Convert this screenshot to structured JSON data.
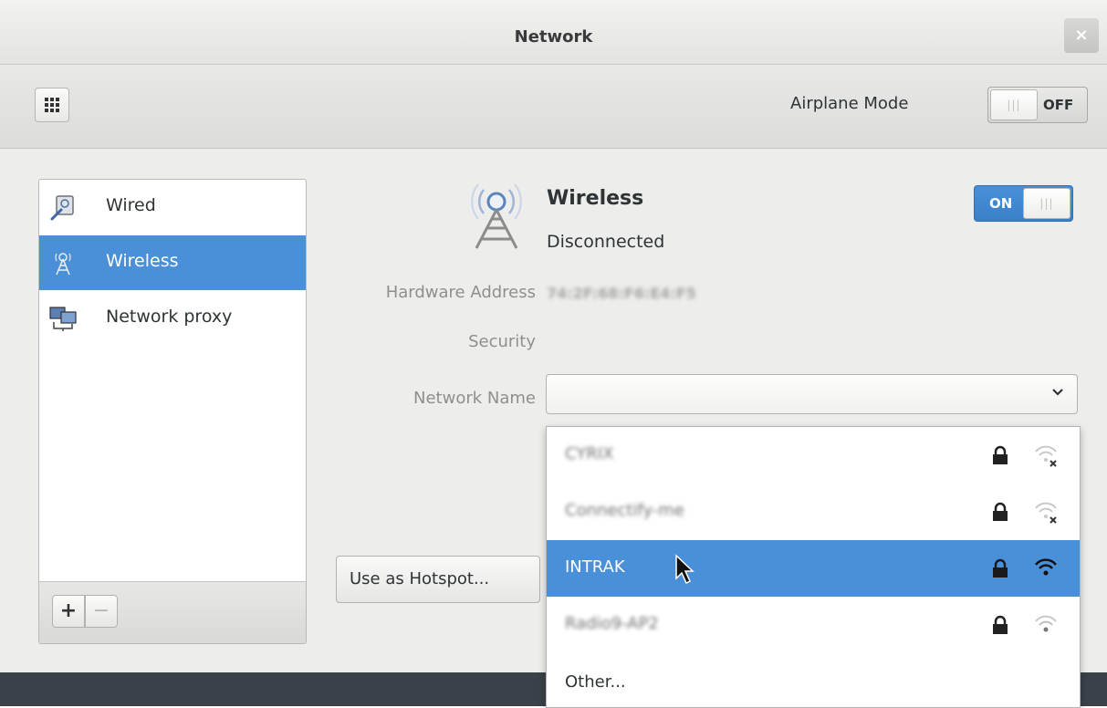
{
  "window": {
    "title": "Network",
    "close_label": "×"
  },
  "toolbar": {
    "airplane_label": "Airplane Mode",
    "airplane_state": "OFF",
    "airplane_on": false
  },
  "sidebar": {
    "items": [
      {
        "label": "Wired",
        "icon": "wired-network-icon",
        "selected": false
      },
      {
        "label": "Wireless",
        "icon": "wireless-network-icon",
        "selected": true
      },
      {
        "label": "Network proxy",
        "icon": "network-proxy-icon",
        "selected": false
      }
    ],
    "add_label": "+",
    "remove_label": "−"
  },
  "device": {
    "name": "Wireless",
    "status": "Disconnected",
    "switch_state": "ON",
    "enabled": true,
    "hardware_address_label": "Hardware Address",
    "hardware_address": "74:2F:68:F6:E4:F5",
    "security_label": "Security",
    "network_name_label": "Network Name",
    "network_name_value": ""
  },
  "hotspot_button": "Use as Hotspot...",
  "network_popup": {
    "networks": [
      {
        "name": "CYRIX",
        "blurred": true,
        "secured": true,
        "signal": "none"
      },
      {
        "name": "Connectify-me",
        "blurred": true,
        "secured": true,
        "signal": "none"
      },
      {
        "name": "INTRAK",
        "blurred": false,
        "secured": true,
        "signal": "excellent",
        "selected": true
      },
      {
        "name": "Radio9-AP2",
        "blurred": true,
        "secured": true,
        "signal": "weak"
      }
    ],
    "other_label": "Other..."
  },
  "colors": {
    "selection": "#4a90d9",
    "window_bg": "#ededeb",
    "muted_label": "#8e908c"
  }
}
